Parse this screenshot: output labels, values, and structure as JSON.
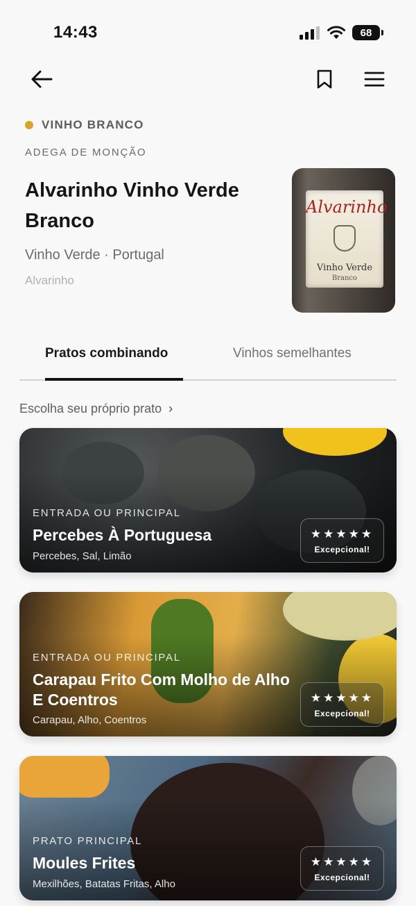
{
  "status_bar": {
    "time": "14:43",
    "battery": "68"
  },
  "nav": {
    "back_icon": "arrow-left-icon",
    "bookmark_icon": "bookmark-icon",
    "menu_icon": "hamburger-menu-icon"
  },
  "wine": {
    "type_label": "VINHO BRANCO",
    "type_color": "#d4a72c",
    "producer": "ADEGA DE MONÇÃO",
    "name": "Alvarinho Vinho Verde Branco",
    "region": "Vinho Verde · Portugal",
    "grape": "Alvarinho",
    "bottle_label": {
      "script": "Alvarinho",
      "line1": "Vinho Verde",
      "line2": "Branco"
    }
  },
  "tabs": [
    {
      "label": "Pratos combinando",
      "active": true
    },
    {
      "label": "Vinhos semelhantes",
      "active": false
    }
  ],
  "choose_dish": {
    "label": "Escolha seu próprio prato",
    "chevron": "›"
  },
  "dishes": [
    {
      "category": "ENTRADA OU PRINCIPAL",
      "title": "Percebes À Portuguesa",
      "ingredients": "Percebes, Sal, Limão",
      "stars": "★★★★★",
      "rating_label": "Excepcional!"
    },
    {
      "category": "ENTRADA OU PRINCIPAL",
      "title": "Carapau Frito Com Molho de Alho E Coentros",
      "ingredients": "Carapau, Alho, Coentros",
      "stars": "★★★★★",
      "rating_label": "Excepcional!"
    },
    {
      "category": "PRATO PRINCIPAL",
      "title": "Moules Frites",
      "ingredients": "Mexilhões, Batatas Fritas, Alho",
      "stars": "★★★★★",
      "rating_label": "Excepcional!"
    }
  ]
}
